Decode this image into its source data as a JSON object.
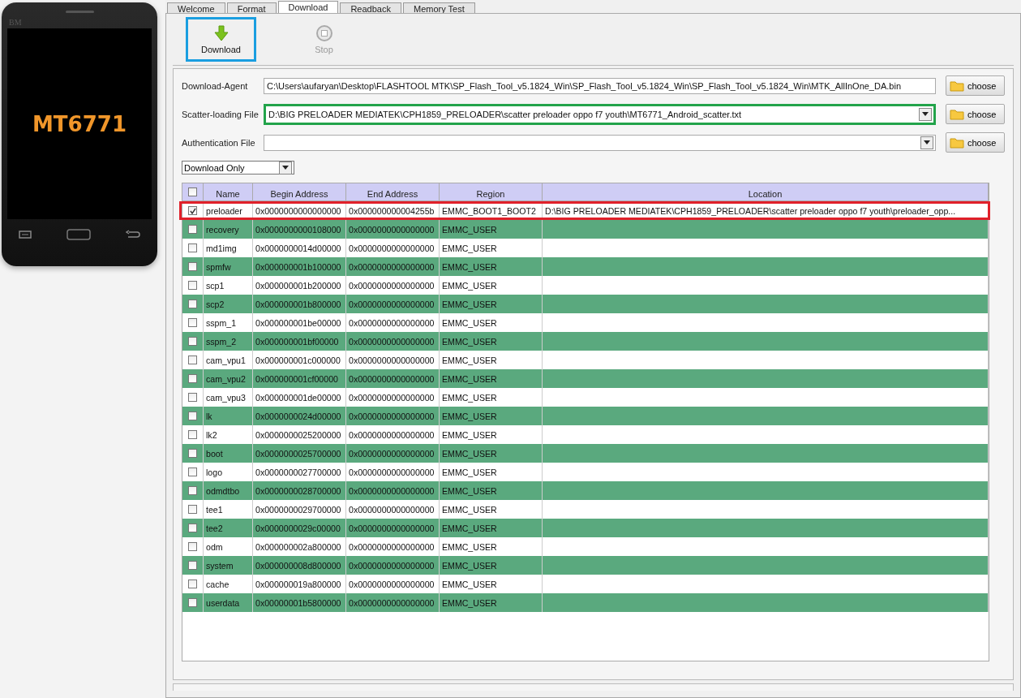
{
  "phone": {
    "brand": "BM",
    "screen_text": "MT6771"
  },
  "tabs": [
    {
      "label": "Welcome",
      "selected": false
    },
    {
      "label": "Format",
      "selected": false
    },
    {
      "label": "Download",
      "selected": true
    },
    {
      "label": "Readback",
      "selected": false
    },
    {
      "label": "Memory Test",
      "selected": false
    }
  ],
  "toolbar": [
    {
      "kind": "download",
      "label": "Download",
      "disabled": false,
      "highlighted": true
    },
    {
      "kind": "stop",
      "label": "Stop",
      "disabled": true,
      "highlighted": false
    }
  ],
  "files": [
    {
      "label": "Download-Agent",
      "value": "C:\\Users\\aufaryan\\Desktop\\FLASHTOOL MTK\\SP_Flash_Tool_v5.1824_Win\\SP_Flash_Tool_v5.1824_Win\\SP_Flash_Tool_v5.1824_Win\\MTK_AllInOne_DA.bin",
      "dropdown": false,
      "highlighted": false,
      "button": "choose"
    },
    {
      "label": "Scatter-loading File",
      "value": "D:\\BIG PRELOADER MEDIATEK\\CPH1859_PRELOADER\\scatter preloader oppo f7 youth\\MT6771_Android_scatter.txt",
      "dropdown": true,
      "highlighted": true,
      "button": "choose"
    },
    {
      "label": "Authentication File",
      "dropdown": true,
      "highlighted": false,
      "button": "choose"
    }
  ],
  "mode": {
    "value": "Download Only"
  },
  "table": {
    "all_checked": false,
    "columns": [
      "Name",
      "Begin Address",
      "End Address",
      "Region",
      "Location"
    ],
    "rows": [
      {
        "checked": true,
        "highlighted": true,
        "name": "preloader",
        "begin": "0x0000000000000000",
        "end": "0x000000000004255b",
        "region": "EMMC_BOOT1_BOOT2",
        "location": "D:\\BIG PRELOADER MEDIATEK\\CPH1859_PRELOADER\\scatter preloader oppo f7 youth\\preloader_opp..."
      },
      {
        "checked": false,
        "highlighted": false,
        "name": "recovery",
        "begin": "0x0000000000108000",
        "end": "0x0000000000000000",
        "region": "EMMC_USER"
      },
      {
        "checked": false,
        "highlighted": false,
        "name": "md1img",
        "begin": "0x0000000014d00000",
        "end": "0x0000000000000000",
        "region": "EMMC_USER"
      },
      {
        "checked": false,
        "highlighted": false,
        "name": "spmfw",
        "begin": "0x000000001b100000",
        "end": "0x0000000000000000",
        "region": "EMMC_USER"
      },
      {
        "checked": false,
        "highlighted": false,
        "name": "scp1",
        "begin": "0x000000001b200000",
        "end": "0x0000000000000000",
        "region": "EMMC_USER"
      },
      {
        "checked": false,
        "highlighted": false,
        "name": "scp2",
        "begin": "0x000000001b800000",
        "end": "0x0000000000000000",
        "region": "EMMC_USER"
      },
      {
        "checked": false,
        "highlighted": false,
        "name": "sspm_1",
        "begin": "0x000000001be00000",
        "end": "0x0000000000000000",
        "region": "EMMC_USER"
      },
      {
        "checked": false,
        "highlighted": false,
        "name": "sspm_2",
        "begin": "0x000000001bf00000",
        "end": "0x0000000000000000",
        "region": "EMMC_USER"
      },
      {
        "checked": false,
        "highlighted": false,
        "name": "cam_vpu1",
        "begin": "0x000000001c000000",
        "end": "0x0000000000000000",
        "region": "EMMC_USER"
      },
      {
        "checked": false,
        "highlighted": false,
        "name": "cam_vpu2",
        "begin": "0x000000001cf00000",
        "end": "0x0000000000000000",
        "region": "EMMC_USER"
      },
      {
        "checked": false,
        "highlighted": false,
        "name": "cam_vpu3",
        "begin": "0x000000001de00000",
        "end": "0x0000000000000000",
        "region": "EMMC_USER"
      },
      {
        "checked": false,
        "highlighted": false,
        "name": "lk",
        "begin": "0x0000000024d00000",
        "end": "0x0000000000000000",
        "region": "EMMC_USER"
      },
      {
        "checked": false,
        "highlighted": false,
        "name": "lk2",
        "begin": "0x0000000025200000",
        "end": "0x0000000000000000",
        "region": "EMMC_USER"
      },
      {
        "checked": false,
        "highlighted": false,
        "name": "boot",
        "begin": "0x0000000025700000",
        "end": "0x0000000000000000",
        "region": "EMMC_USER"
      },
      {
        "checked": false,
        "highlighted": false,
        "name": "logo",
        "begin": "0x0000000027700000",
        "end": "0x0000000000000000",
        "region": "EMMC_USER"
      },
      {
        "checked": false,
        "highlighted": false,
        "name": "odmdtbo",
        "begin": "0x0000000028700000",
        "end": "0x0000000000000000",
        "region": "EMMC_USER"
      },
      {
        "checked": false,
        "highlighted": false,
        "name": "tee1",
        "begin": "0x0000000029700000",
        "end": "0x0000000000000000",
        "region": "EMMC_USER"
      },
      {
        "checked": false,
        "highlighted": false,
        "name": "tee2",
        "begin": "0x0000000029c00000",
        "end": "0x0000000000000000",
        "region": "EMMC_USER"
      },
      {
        "checked": false,
        "highlighted": false,
        "name": "odm",
        "begin": "0x000000002a800000",
        "end": "0x0000000000000000",
        "region": "EMMC_USER"
      },
      {
        "checked": false,
        "highlighted": false,
        "name": "system",
        "begin": "0x000000008d800000",
        "end": "0x0000000000000000",
        "region": "EMMC_USER"
      },
      {
        "checked": false,
        "highlighted": false,
        "name": "cache",
        "begin": "0x000000019a800000",
        "end": "0x0000000000000000",
        "region": "EMMC_USER"
      },
      {
        "checked": false,
        "highlighted": false,
        "name": "userdata",
        "begin": "0x00000001b5800000",
        "end": "0x0000000000000000",
        "region": "EMMC_USER"
      }
    ]
  }
}
